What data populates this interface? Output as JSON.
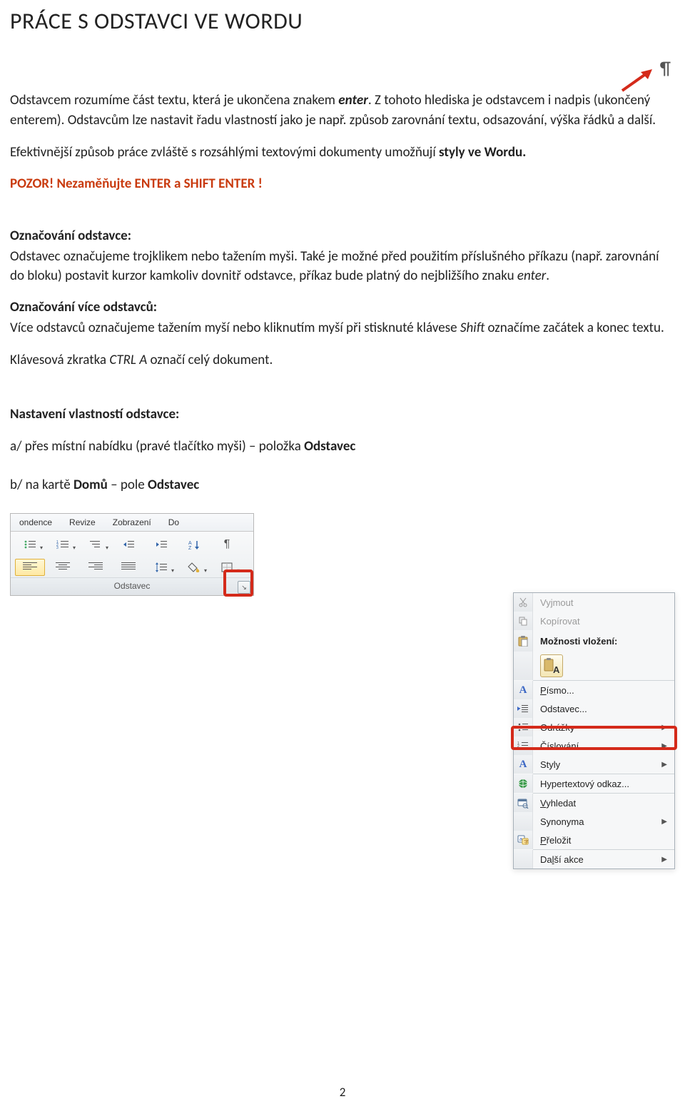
{
  "title": "PRÁCE S ODSTAVCI VE WORDU",
  "para1_a": "Odstavcem rozumíme část textu, která je ukončena znakem ",
  "para1_enter": "enter",
  "para1_b": ". Z tohoto hlediska je odstavcem i nadpis (ukončený enterem). Odstavcům lze nastavit řadu vlastností jako je např. způsob zarovnání textu, odsazování, výška řádků a další.",
  "para2_a": "Efektivnější způsob práce zvláště s rozsáhlými textovými dokumenty umožňují ",
  "para2_bold": "styly ve Wordu.",
  "warn": "POZOR! Nezaměňujte ENTER a SHIFT ENTER !",
  "sel_head": "Označování odstavce:",
  "sel_body_a": "Odstavec označujeme trojklikem nebo tažením myši. Také je možné před použitím příslušného příkazu (např. zarovnání do bloku) postavit kurzor kamkoliv dovnitř odstavce, příkaz bude platný do nejbližšího znaku ",
  "sel_body_em": "enter",
  "sel_body_b": ".",
  "multi_head": "Označování více odstavců:",
  "multi_body_a": "Více odstavců označujeme tažením myší nebo kliknutím myší při stisknuté klávese ",
  "multi_body_em": "Shift",
  "multi_body_b": " označíme začátek a konec textu.",
  "ctrl_a_a": "Klávesová zkratka ",
  "ctrl_a_em": "CTRL A",
  "ctrl_a_b": " označí celý dokument.",
  "props_head": "Nastavení vlastností odstavce:",
  "opt_a_a": "a/ přes místní nabídku (pravé tlačítko myši) – položka ",
  "opt_a_bold": "Odstavec",
  "opt_b_a": "b/ na kartě ",
  "opt_b_bold1": "Domů",
  "opt_b_b": " – pole ",
  "opt_b_bold2": "Odstavec",
  "ribbon": {
    "tabs": [
      "ondence",
      "Revize",
      "Zobrazení",
      "Do"
    ],
    "group": "Odstavec"
  },
  "context_menu": {
    "items": [
      {
        "label": "Vyjmout",
        "icon": "cut-icon",
        "disabled": true
      },
      {
        "label": "Kopírovat",
        "icon": "copy-icon",
        "disabled": true
      },
      {
        "label": "Možnosti vložení:",
        "icon": "paste-icon",
        "bold": true,
        "noarrow": true
      },
      {
        "paste_option": true
      },
      {
        "label": "Písmo...",
        "icon": "font-icon",
        "accel": "P"
      },
      {
        "label": "Odstavec...",
        "icon": "paragraph-icon",
        "hl": true
      },
      {
        "label": "Odrážky",
        "icon": "bullets-icon",
        "arrow": true
      },
      {
        "label": "Číslování",
        "icon": "numbering-icon",
        "arrow": true
      },
      {
        "label": "Styly",
        "icon": "styles-icon",
        "arrow": true
      },
      {
        "label": "Hypertextový odkaz...",
        "icon": "link-icon"
      },
      {
        "label": "Vyhledat",
        "icon": "search-icon",
        "accel": "V"
      },
      {
        "label": "Synonyma",
        "icon": "blank-icon",
        "arrow": true
      },
      {
        "label": "Přeložit",
        "icon": "translate-icon",
        "accel": "P"
      },
      {
        "label": "Další akce",
        "icon": "blank-icon",
        "arrow": true,
        "accel": "l"
      }
    ]
  },
  "page_number": "2"
}
